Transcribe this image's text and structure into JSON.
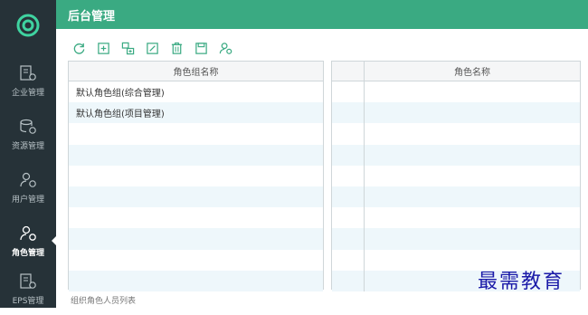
{
  "header": {
    "title": "后台管理"
  },
  "sidebar": {
    "items": [
      {
        "label": "企业管理",
        "icon": "enterprise-icon",
        "active": false
      },
      {
        "label": "资源管理",
        "icon": "database-icon",
        "active": false
      },
      {
        "label": "用户管理",
        "icon": "user-settings-icon",
        "active": false
      },
      {
        "label": "角色管理",
        "icon": "role-icon",
        "active": true
      },
      {
        "label": "EPS管理",
        "icon": "eps-icon",
        "active": false
      }
    ]
  },
  "toolbar": {
    "buttons": [
      "refresh-icon",
      "add-icon",
      "add-child-icon",
      "edit-icon",
      "delete-icon",
      "save-icon",
      "role-settings-icon"
    ]
  },
  "left_table": {
    "header": "角色组名称",
    "rows": [
      "默认角色组(综合管理)",
      "默认角色组(项目管理)"
    ]
  },
  "right_table": {
    "header": "角色名称"
  },
  "footer": {
    "caption": "组织角色人员列表"
  },
  "watermark": "最需教育",
  "colors": {
    "sidebar": "#263238",
    "header": "#3aaa82",
    "row_alt": "#eef7fb"
  }
}
